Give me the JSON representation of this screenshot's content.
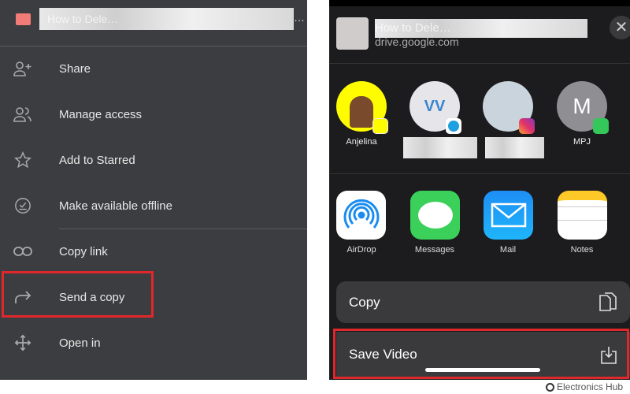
{
  "left_menu": {
    "file_title": "How to Dele…",
    "items": [
      {
        "label": "Share",
        "icon": "person-add-icon"
      },
      {
        "label": "Manage access",
        "icon": "people-icon"
      },
      {
        "label": "Add to Starred",
        "icon": "star-icon"
      },
      {
        "label": "Make available offline",
        "icon": "offline-check-icon"
      },
      {
        "label": "Copy link",
        "icon": "link-icon"
      },
      {
        "label": "Send a copy",
        "icon": "forward-arrow-icon",
        "highlighted": true
      },
      {
        "label": "Open in",
        "icon": "move-arrows-icon"
      }
    ]
  },
  "share_sheet": {
    "title": "How to Dele…",
    "domain": "drive.google.com",
    "contacts": [
      {
        "name": "Anjelina",
        "app": "snapchat",
        "color": "#fffc00"
      },
      {
        "name": "",
        "initials": "VV",
        "app": "skype",
        "color": "#e5e5ea"
      },
      {
        "name": "",
        "app": "instagram",
        "color": "#c9d4dc"
      },
      {
        "name": "MPJ",
        "initials": "M",
        "app": "messages",
        "color": "#8e8e93"
      }
    ],
    "apps": [
      {
        "label": "AirDrop"
      },
      {
        "label": "Messages"
      },
      {
        "label": "Mail"
      },
      {
        "label": "Notes"
      }
    ],
    "actions": [
      {
        "label": "Copy",
        "icon": "copy-icon"
      },
      {
        "label": "Save Video",
        "icon": "save-download-icon",
        "highlighted": true
      }
    ]
  },
  "watermark": "Electronics Hub",
  "colors": {
    "highlight": "#e0282c",
    "left_bg": "#3c3d40",
    "right_bg": "#1c1c1e"
  }
}
